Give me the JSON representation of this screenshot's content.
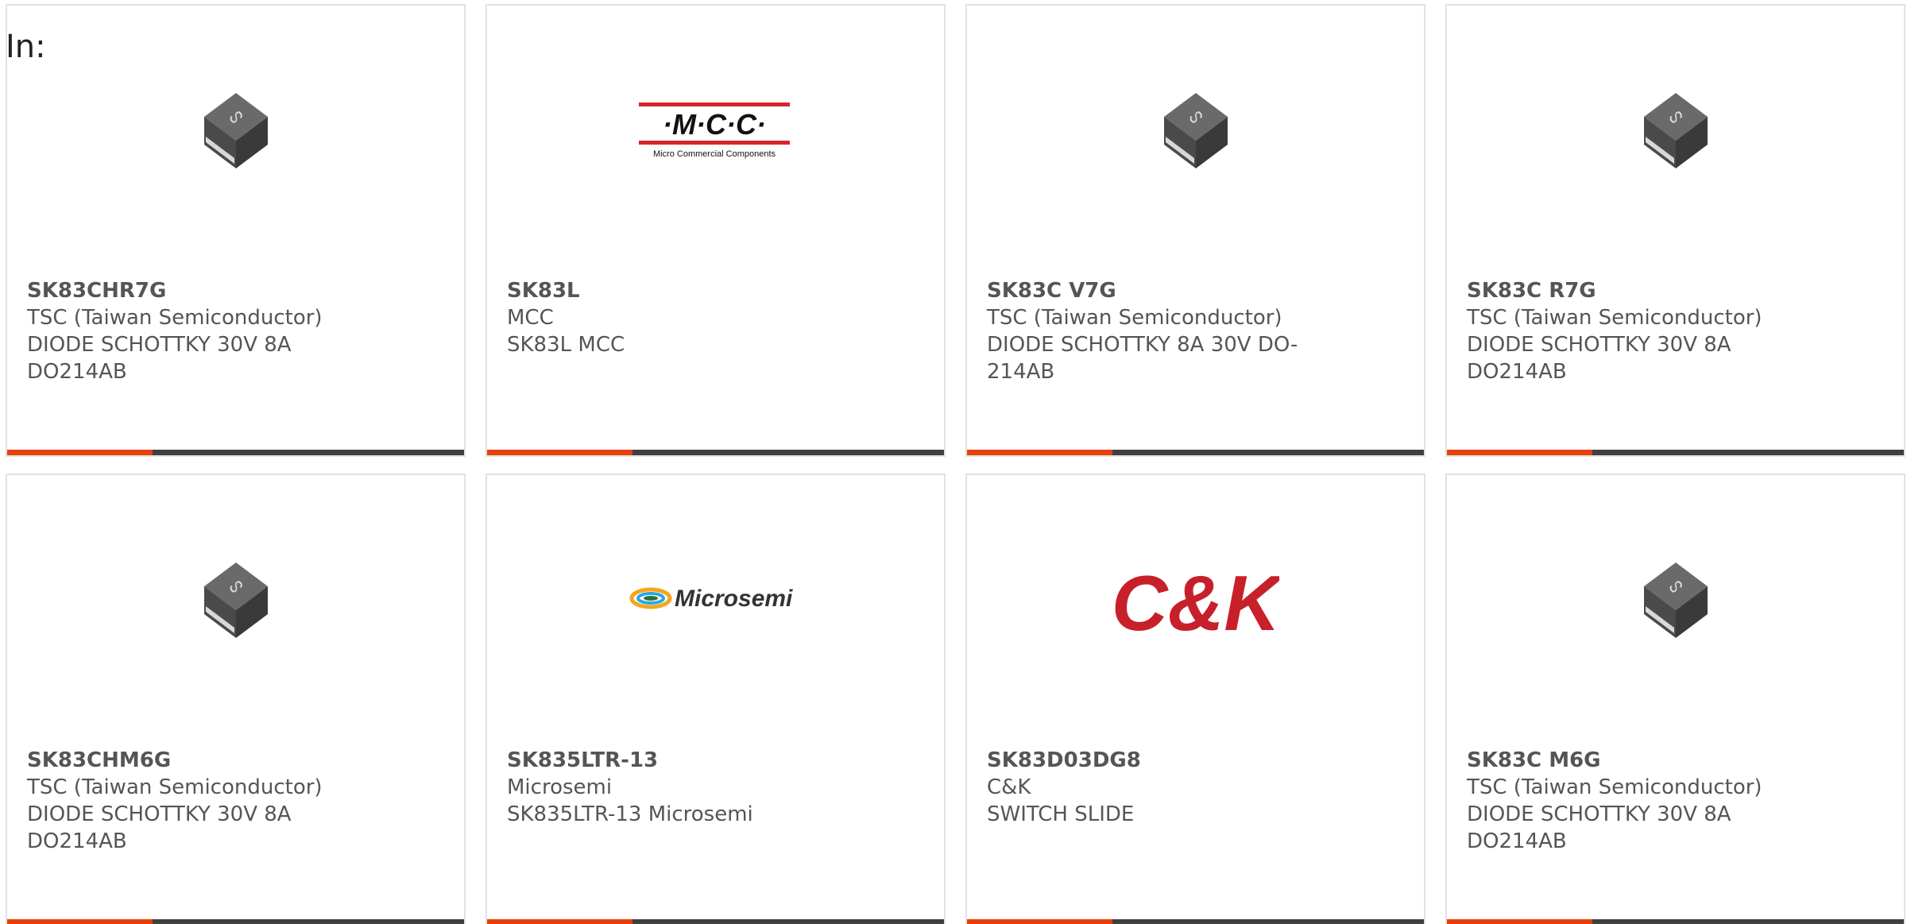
{
  "header": {
    "in_label": "In:"
  },
  "colors": {
    "accent": "#e8400c",
    "bar": "#404040",
    "text": "#555555",
    "border": "#e2e2e2"
  },
  "products": [
    {
      "part": "SK83CHR7G",
      "manufacturer": "TSC (Taiwan Semiconductor)",
      "description": "DIODE SCHOTTKY 30V 8A DO214AB",
      "image": "chip-package-icon"
    },
    {
      "part": "SK83L",
      "manufacturer": "MCC",
      "description": "SK83L MCC",
      "image": "mcc-logo",
      "logo_text": "·M·C·C·",
      "logo_subtext": "Micro Commercial Components"
    },
    {
      "part": "SK83C V7G",
      "manufacturer": "TSC (Taiwan Semiconductor)",
      "description": "DIODE SCHOTTKY 8A 30V DO-214AB",
      "image": "chip-package-icon"
    },
    {
      "part": "SK83C R7G",
      "manufacturer": "TSC (Taiwan Semiconductor)",
      "description": "DIODE SCHOTTKY 30V 8A DO214AB",
      "image": "chip-package-icon"
    },
    {
      "part": "SK83CHM6G",
      "manufacturer": "TSC (Taiwan Semiconductor)",
      "description": "DIODE SCHOTTKY 30V 8A DO214AB",
      "image": "chip-package-icon"
    },
    {
      "part": "SK835LTR-13",
      "manufacturer": "Microsemi",
      "description": "SK835LTR-13 Microsemi",
      "image": "microsemi-logo",
      "logo_text": "Microsemi"
    },
    {
      "part": "SK83D03DG8",
      "manufacturer": "C&K",
      "description": "SWITCH SLIDE",
      "image": "ck-logo",
      "logo_text": "C&K"
    },
    {
      "part": "SK83C M6G",
      "manufacturer": "TSC (Taiwan Semiconductor)",
      "description": "DIODE SCHOTTKY 30V 8A DO214AB",
      "image": "chip-package-icon"
    }
  ]
}
